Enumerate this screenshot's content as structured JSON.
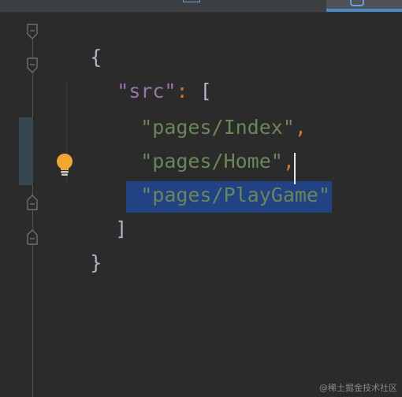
{
  "editor": {
    "lines": {
      "open_brace": "{",
      "src_key": "\"src\"",
      "src_colon": ":",
      "src_bracket": "[",
      "item1_str": "\"pages/Index\"",
      "item1_comma": ",",
      "item2_str": "\"pages/Home\"",
      "item2_comma": ",",
      "item3_str": "\"pages/PlayGame\"",
      "close_bracket": "]",
      "close_brace": "}"
    },
    "icons": {
      "intention": "lightbulb-icon",
      "fold": "fold-marker-icon"
    },
    "colors": {
      "background": "#2b2b2b",
      "string": "#6a8759",
      "key": "#9876aa",
      "punctuation": "#cc7832",
      "selection": "#214283",
      "bulb": "#f0a732"
    }
  },
  "watermark": "@稀土掘金技术社区"
}
